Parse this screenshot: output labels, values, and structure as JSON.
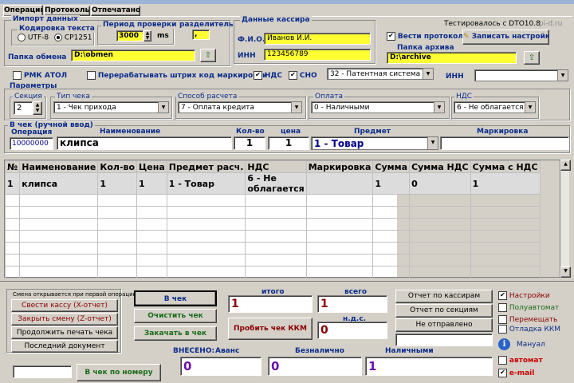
{
  "tabs": [
    "Операции",
    "Протоколы",
    "Отпечатано"
  ],
  "import": {
    "title": "Импорт данных",
    "encoding_title": "Кодировка текста",
    "utf8": "UTF-8",
    "cp1251": "CP1251",
    "period_title": "Период проверки",
    "period_value": "3000",
    "period_unit": "ms",
    "separator_title": "разделитель",
    "separator_value": ",",
    "folder_label": "Папка обмена",
    "folder_value": "D:\\obmen"
  },
  "cashier": {
    "title": "Данные кассира",
    "fio_label": "Ф.И.О.",
    "fio_value": "Иванов И.И.",
    "inn_label": "ИНН",
    "inn_value": "123456789"
  },
  "top_right": {
    "tested": "Тестировалось с DTO10.8",
    "site": "pi-d.ru",
    "log_label": "Вести протокол",
    "save_settings": "Записать настройки",
    "archive_label": "Папка архива",
    "archive_value": "D:\\archive"
  },
  "options": {
    "rmk": "РМК АТОЛ",
    "reprocess": "Перерабатывать штрих код маркировки",
    "nds": "НДС",
    "sno": "СНО",
    "sno_value": "32 - Патентная система на",
    "inn_label": "ИНН",
    "inn_value": ""
  },
  "params": {
    "title": "Параметры",
    "section_label": "Секция",
    "section_value": "2",
    "check_type_label": "Тип чека",
    "check_type_value": "1 - Чек прихода",
    "calc_label": "Способ расчета",
    "calc_value": "7 - Оплата кредита",
    "pay_label": "Оплата",
    "pay_value": "0 - Наличными",
    "nds_label": "НДС",
    "nds_value": "6 - Не облагается"
  },
  "manual": {
    "title": "В чек (ручной ввод)",
    "op_label": "Операция",
    "name_label": "Наименование",
    "qty_label": "Кол-во",
    "price_label": "цена",
    "subject_label": "Предмет",
    "mark_label": "Маркировка",
    "op_value": "10000000",
    "name_value": "клипса",
    "qty_value": "1",
    "price_value": "1",
    "subject_value": "1 - Товар",
    "mark_value": ""
  },
  "table": {
    "headers": [
      "№",
      "Наименование",
      "Кол-во",
      "Цена",
      "Предмет расч.",
      "НДС",
      "Маркировка",
      "Сумма",
      "Сумма НДС",
      "Сумма с НДС"
    ],
    "rows": [
      [
        "1",
        "клипса",
        "1",
        "1",
        "1 - Товар",
        "6 - Не облагается",
        "",
        "1",
        "0",
        "1"
      ]
    ]
  },
  "bottom": {
    "note": "Смена открывается при первой операции",
    "x_report": "Свести кассу (X-отчет)",
    "z_report": "Закрыть смену (Z-отчет)",
    "continue_print": "Продолжить печать чека",
    "last_doc": "Последний документ",
    "to_check": "В чек",
    "clear_check": "Очистить чек",
    "close_check": "Закачать в чек",
    "punch": "Пробить чек ККМ",
    "itogo_label": "итого",
    "itogo_value": "1",
    "vsego_label": "всего",
    "vsego_value": "1",
    "nds_label": "н.д.с.",
    "nds_value": "0",
    "report_cashiers": "Отчет по кассирам",
    "report_sections": "Отчет по секциям",
    "not_sent": "Не отправлено",
    "paid_label": "ВНЕСЕНО:",
    "avans_label": "Аванс",
    "avans_value": "0",
    "card_label": "Безналично",
    "card_value": "0",
    "cash_label": "Наличными",
    "cash_value": "1",
    "by_number": "В чек по номеру",
    "by_number_value": "",
    "side": {
      "settings": "Настройки",
      "semi": "Полуавтомат",
      "move": "Перемещать",
      "debug": "Отладка ККМ",
      "manual": "Мануал",
      "auto": "автомат",
      "email": "e-mail"
    }
  }
}
